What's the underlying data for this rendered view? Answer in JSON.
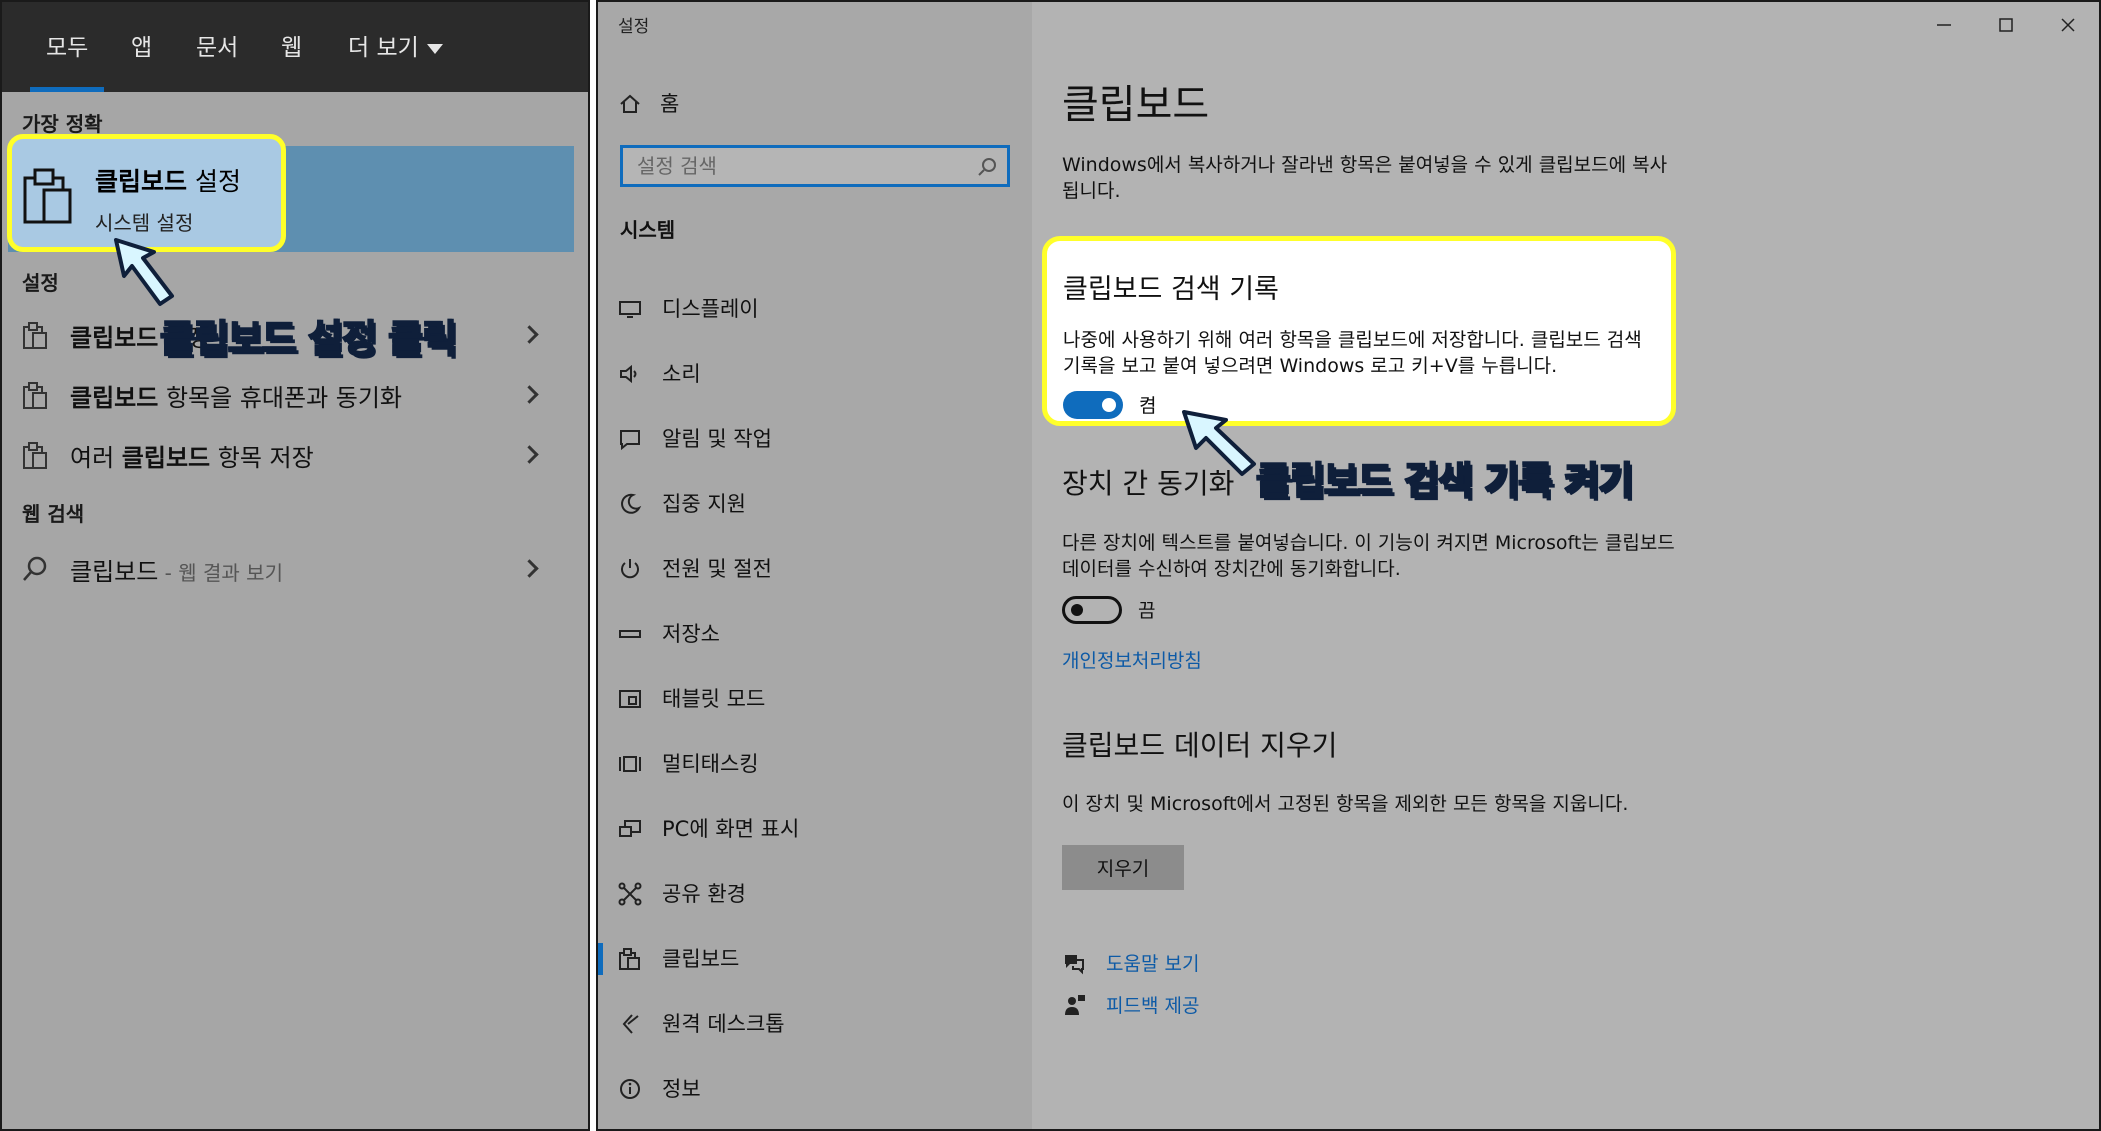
{
  "search_panel": {
    "tabs": [
      {
        "label": "모두",
        "active": true
      },
      {
        "label": "앱"
      },
      {
        "label": "문서"
      },
      {
        "label": "웹"
      },
      {
        "label": "더 보기"
      }
    ],
    "best_match_heading": "가장 정확",
    "best_match": {
      "title_bold": "클립보드",
      "title_rest": " 설정",
      "subtitle": "시스템 설정"
    },
    "settings_heading": "설정",
    "settings_results": [
      {
        "pre": "",
        "bold": "클립보드",
        "post": " 설정"
      },
      {
        "pre": "",
        "bold": "클립보드",
        "post": " 항목을 휴대폰과 동기화"
      },
      {
        "pre": "여러 ",
        "bold": "클립보드",
        "post": " 항목 저장"
      }
    ],
    "web_heading": "웹 검색",
    "web_result": {
      "term": "클립보드",
      "suffix": " - 웹 결과 보기"
    },
    "annotation": "클립보드 설정 클릭"
  },
  "settings": {
    "window_title": "설정",
    "home_label": "홈",
    "search_placeholder": "설정 검색",
    "section_heading": "시스템",
    "nav_items": [
      {
        "label": "디스플레이",
        "icon": "display-icon"
      },
      {
        "label": "소리",
        "icon": "speaker-icon"
      },
      {
        "label": "알림 및 작업",
        "icon": "notification-icon"
      },
      {
        "label": "집중 지원",
        "icon": "moon-icon"
      },
      {
        "label": "전원 및 절전",
        "icon": "power-icon"
      },
      {
        "label": "저장소",
        "icon": "storage-icon"
      },
      {
        "label": "태블릿 모드",
        "icon": "tablet-icon"
      },
      {
        "label": "멀티태스킹",
        "icon": "multitasking-icon"
      },
      {
        "label": "PC에 화면 표시",
        "icon": "project-icon"
      },
      {
        "label": "공유 환경",
        "icon": "share-icon"
      },
      {
        "label": "클립보드",
        "icon": "clipboard-icon",
        "active": true
      },
      {
        "label": "원격 데스크톱",
        "icon": "remote-desktop-icon"
      },
      {
        "label": "정보",
        "icon": "info-icon"
      }
    ],
    "page_title": "클립보드",
    "intro": "Windows에서 복사하거나 잘라낸 항목은 붙여넣을 수 있게 클립보드에 복사됩니다.",
    "history": {
      "title": "클립보드 검색 기록",
      "description": "나중에 사용하기 위해 여러 항목을 클립보드에 저장합니다. 클립보드 검색 기록을 보고 붙여 넣으려면 Windows 로고 키+V를 누릅니다.",
      "toggle_state": "켬",
      "on": true
    },
    "annotation": "클립보드 검색 기록 켜기",
    "sync": {
      "title": "장치 간 동기화",
      "description": "다른 장치에 텍스트를 붙여넣습니다. 이 기능이 켜지면 Microsoft는 클립보드 데이터를 수신하여 장치간에 동기화합니다.",
      "toggle_state": "끔",
      "on": false,
      "privacy_link": "개인정보처리방침"
    },
    "clear": {
      "title": "클립보드 데이터 지우기",
      "description": "이 장치 및 Microsoft에서 고정된 항목을 제외한 모든 항목을 지웁니다.",
      "button": "지우기"
    },
    "help_links": [
      {
        "label": "도움말 보기",
        "icon": "help-icon"
      },
      {
        "label": "피드백 제공",
        "icon": "feedback-icon"
      }
    ]
  },
  "colors": {
    "accent": "#0f6cbd",
    "highlight": "#ffff2a",
    "link": "#0d5aa6"
  }
}
